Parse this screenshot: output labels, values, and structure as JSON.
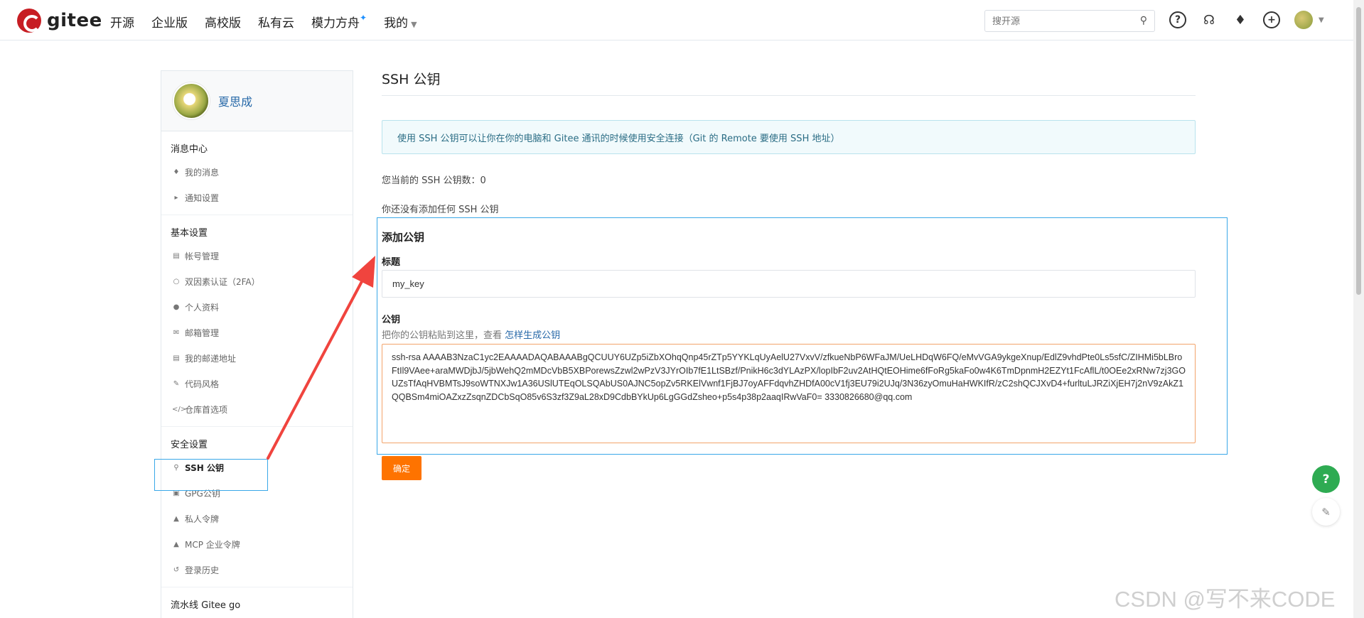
{
  "brand": {
    "name": "gitee",
    "color": "#c71d23"
  },
  "nav": {
    "items": [
      "开源",
      "企业版",
      "高校版",
      "私有云",
      "模力方舟",
      "我的"
    ],
    "star": "✦"
  },
  "search": {
    "placeholder": "搜开源"
  },
  "sidebar": {
    "user_name": "夏思成",
    "groups": [
      {
        "title": "消息中心",
        "items": [
          "我的消息",
          "通知设置"
        ]
      },
      {
        "title": "基本设置",
        "items": [
          "帐号管理",
          "双因素认证（2FA）",
          "个人资料",
          "邮箱管理",
          "我的邮递地址",
          "代码风格",
          "仓库首选项"
        ]
      },
      {
        "title": "安全设置",
        "items": [
          "SSH 公钥",
          "GPG公钥",
          "私人令牌",
          "MCP 企业令牌",
          "登录历史"
        ]
      },
      {
        "title": "流水线 Gitee go",
        "items": []
      }
    ],
    "active_item": "SSH 公钥"
  },
  "main": {
    "title": "SSH 公钥",
    "info": "使用 SSH 公钥可以让你在你的电脑和 Gitee 通讯的时候使用安全连接（Git 的 Remote 要使用 SSH 地址）",
    "count_label": "您当前的 SSH 公钥数：",
    "count_value": "0",
    "none_text": "你还没有添加任何 SSH 公钥",
    "add_title": "添加公钥",
    "title_label": "标题",
    "title_value": "my_key",
    "key_label": "公钥",
    "key_hint": "把你的公钥粘贴到这里，查看",
    "key_hint_link": "怎样生成公钥",
    "key_value": "ssh-rsa AAAAB3NzaC1yc2EAAAADAQABAAABgQCUUY6UZp5iZbXOhqQnp45rZTp5YYKLqUyAelU27VxvV/zfkueNbP6WFaJM/UeLHDqW6FQ/eMvVGA9ykgeXnup/EdlZ9vhdPte0Ls5sfC/ZIHMi5bLBroFtIl9VAee+araMWDjbJ/5jbWehQ2mMDcVbB5XBPorewsZzwl2wPzV3JYrOIb7fE1LtSBzf/PnikH6c3dYLAzPX/lopIbF2uv2AtHQtEOHime6fFoRg5kaFo0w4K6TmDpnmH2EZYt1FcAflL/t0OEe2xRNw7zj3GOUZsTfAqHVBMTsJ9soWTNXJw1A36USlUTEqOLSQAbUS0AJNC5opZv5RKElVwnf1FjBJ7oyAFFdqvhZHDfA00cV1fj3EU79i2UJq/3N36zyOmuHaHWKIfR/zC2shQCJXvD4+furltuLJRZiXjEH7j2nV9zAkZ1QQBSm4miOAZxzZsqnZDCbSqO85v6S3zf3Z9aL28xD9CdbBYkUp6LgGGdZsheo+p5s4p38p2aaqIRwVaF0= 3330826680@qq.com",
    "confirm_label": "确定"
  },
  "floating": {
    "help": "?",
    "edit": "✎"
  },
  "watermark": "CSDN @写不来CODE",
  "colors": {
    "accent": "#fe7300",
    "link": "#2769a8",
    "highlight": "#3aa8e8",
    "annotation": "#f0443e",
    "help": "#2eab52"
  },
  "icons": {
    "search": "search-icon",
    "help": "question-icon",
    "tip": "lightbulb-icon",
    "bell": "bell-icon",
    "add": "plus-circle-icon"
  }
}
